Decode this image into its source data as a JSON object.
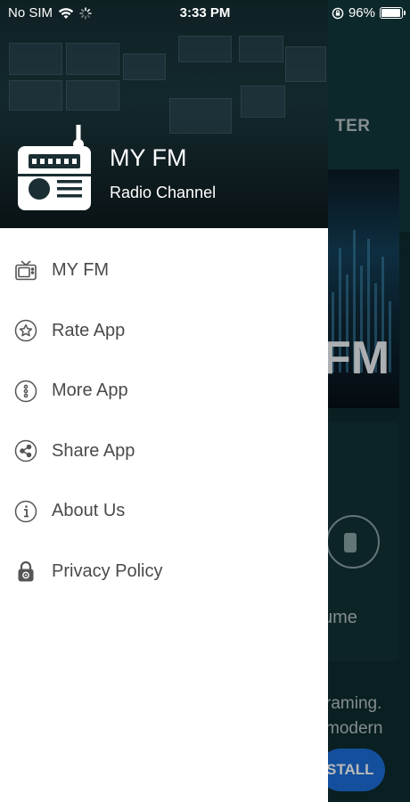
{
  "status_bar": {
    "carrier": "No SIM",
    "time": "3:33 PM",
    "battery": "96%",
    "battery_level": 0.96
  },
  "drawer": {
    "app_name": "MY FM",
    "app_subtitle": "Radio Channel",
    "menu": [
      {
        "label": "MY FM",
        "icon": "tv-icon"
      },
      {
        "label": "Rate App",
        "icon": "star-icon"
      },
      {
        "label": "More App",
        "icon": "more-dots-icon"
      },
      {
        "label": "Share App",
        "icon": "share-icon"
      },
      {
        "label": "About Us",
        "icon": "info-icon"
      },
      {
        "label": "Privacy Policy",
        "icon": "lock-icon"
      }
    ]
  },
  "background": {
    "tab_fragment": "TER",
    "logo_fragment": "FM",
    "volume_fragment": "ume",
    "desc_line1": "raming.",
    "desc_line2": "modern",
    "install_fragment": "STALL"
  },
  "colors": {
    "accent_blue": "#1b6ed8",
    "icon_gray": "#555555",
    "text_gray": "#4a4a4a"
  }
}
